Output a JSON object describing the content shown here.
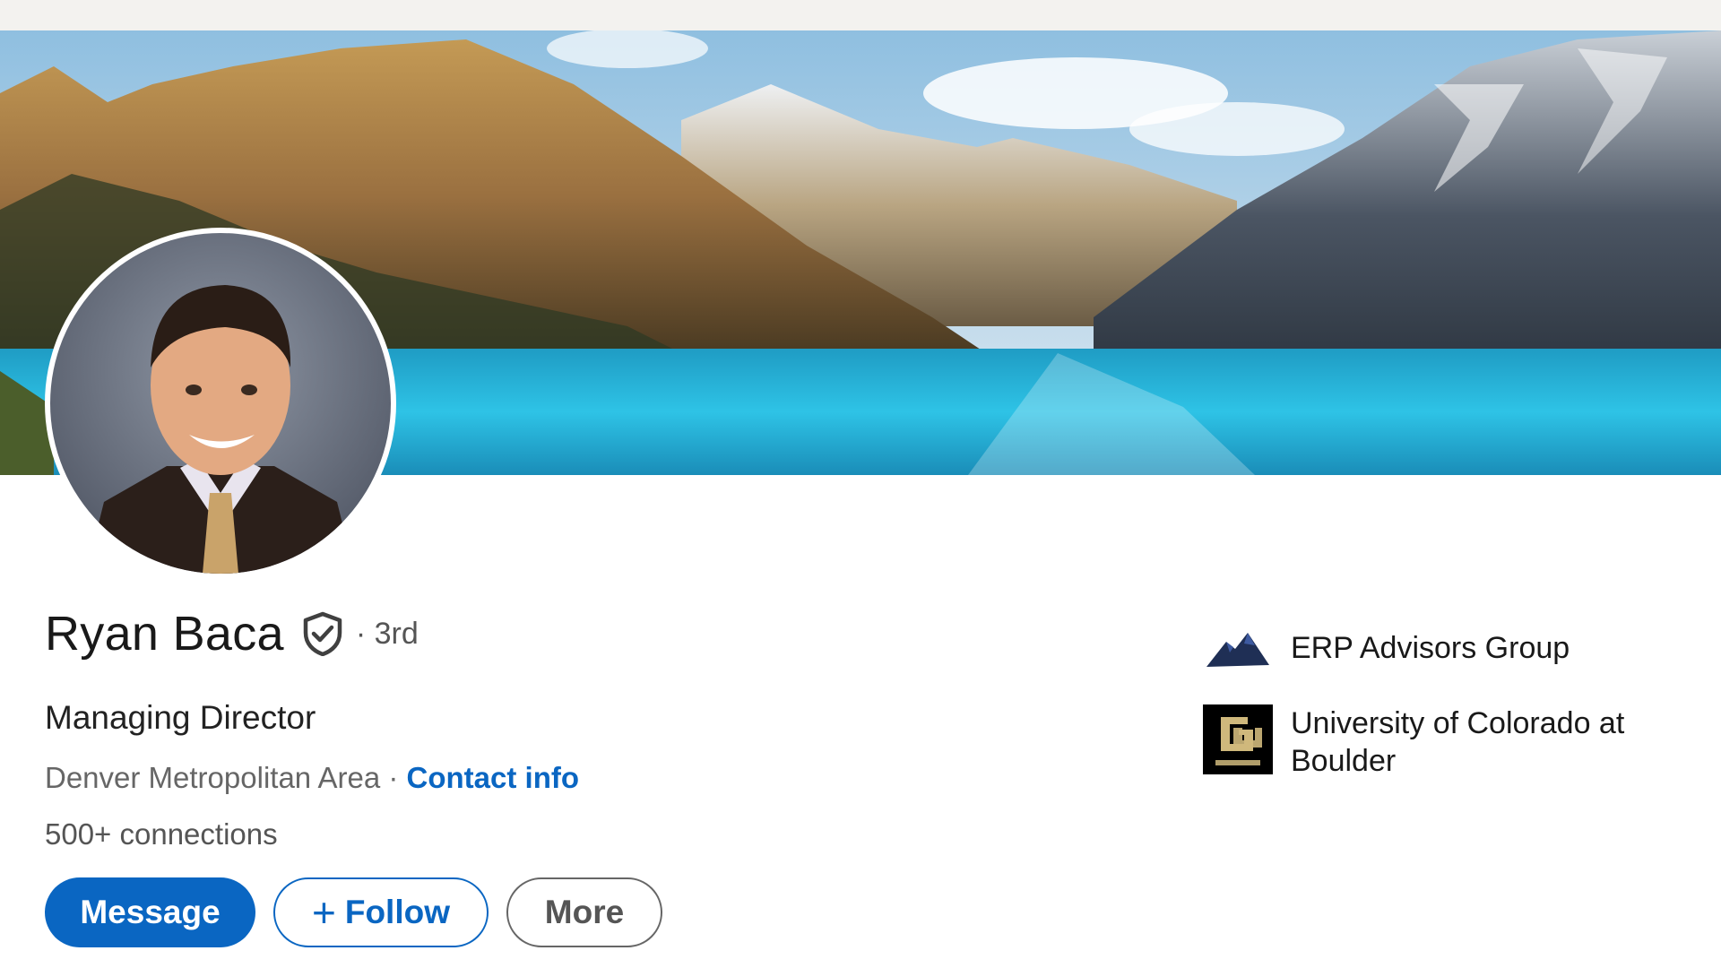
{
  "profile": {
    "name": "Ryan Baca",
    "degree": "· 3rd",
    "headline": "Managing Director",
    "location": "Denver Metropolitan Area ·",
    "contact_label": "Contact info",
    "connections": "500+ connections"
  },
  "actions": {
    "message": "Message",
    "follow_plus": "+",
    "follow": "Follow",
    "more": "More"
  },
  "experience": {
    "company": "ERP Advisors Group",
    "school": "University of Colorado at Boulder"
  },
  "icons": {
    "verified": "shield-check-icon",
    "company_logo": "mountain-logo-icon",
    "school_logo": "cu-boulder-logo-icon"
  },
  "colors": {
    "accent": "#0a66c2",
    "text": "#191919",
    "muted": "#666666"
  }
}
